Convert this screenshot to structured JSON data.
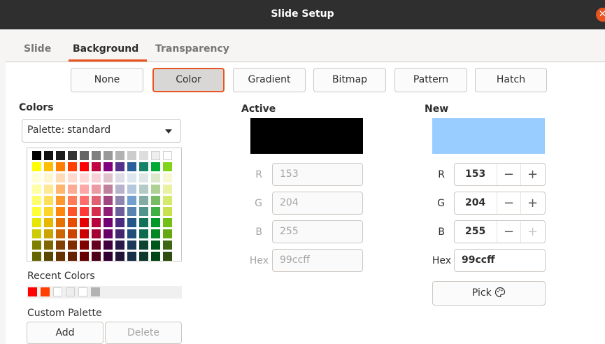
{
  "window": {
    "title": "Slide Setup"
  },
  "tabs": [
    "Slide",
    "Background",
    "Transparency"
  ],
  "fill_types": [
    "None",
    "Color",
    "Gradient",
    "Bitmap",
    "Pattern",
    "Hatch"
  ],
  "selected_fill_type": "Color",
  "colors": {
    "heading": "Colors",
    "palette_label": "Palette:",
    "palette_value": "standard",
    "recent_label": "Recent Colors",
    "custom_label": "Custom Palette",
    "add_label": "Add",
    "delete_label": "Delete"
  },
  "palette_grid": [
    [
      "#000000",
      "#111111",
      "#1c1c1c",
      "#333333",
      "#666666",
      "#808080",
      "#999999",
      "#b2b2b2",
      "#cccccc",
      "#dddddd",
      "#eeeeee",
      "#ffffff"
    ],
    [
      "#ffff00",
      "#ffbf00",
      "#ff8000",
      "#ff4000",
      "#ff0000",
      "#bf0041",
      "#800080",
      "#55308d",
      "#2a6099",
      "#158466",
      "#00a933",
      "#81d41a"
    ],
    [
      "#ffffd7",
      "#fff5ce",
      "#ffdbb6",
      "#ffd8ce",
      "#ffd7d7",
      "#f7d1d5",
      "#e0c2cd",
      "#dedce6",
      "#dee6ef",
      "#dee7e5",
      "#dde8cb",
      "#f6f9d4"
    ],
    [
      "#ffffa6",
      "#ffe994",
      "#ffb66c",
      "#ffaa95",
      "#ffa6a6",
      "#ec9ba4",
      "#bf819e",
      "#b7b3ca",
      "#b4c7dc",
      "#b3cac7",
      "#afd095",
      "#e8f2a1"
    ],
    [
      "#ffff6d",
      "#ffde59",
      "#ff972f",
      "#ff7b59",
      "#ff6d6d",
      "#e16173",
      "#a1467e",
      "#8e86ae",
      "#729fcf",
      "#81aca6",
      "#77bc65",
      "#d4ea6b"
    ],
    [
      "#ffff38",
      "#ffd428",
      "#ff860d",
      "#ff5429",
      "#ff3838",
      "#d62e4e",
      "#8d1d75",
      "#6b5e9b",
      "#5983b0",
      "#50938a",
      "#3faf46",
      "#c9e14f"
    ],
    [
      "#e6e600",
      "#e6b800",
      "#e67300",
      "#e64d00",
      "#e60000",
      "#b8003a",
      "#730073",
      "#4c2a7f",
      "#25568a",
      "#127259",
      "#009929",
      "#73bf15"
    ],
    [
      "#cccc00",
      "#cca300",
      "#cc6600",
      "#cc4400",
      "#cc0000",
      "#a30034",
      "#660066",
      "#432570",
      "#214d7a",
      "#0f6b4e",
      "#008724",
      "#66a812"
    ],
    [
      "#808000",
      "#7f6600",
      "#804000",
      "#802b00",
      "#800000",
      "#660020",
      "#400040",
      "#2a174a",
      "#1a3a59",
      "#0d4333",
      "#00551a",
      "#3e6613"
    ],
    [
      "#666600",
      "#594700",
      "#663300",
      "#662200",
      "#660000",
      "#4d0018",
      "#330033",
      "#221339",
      "#152f47",
      "#0a3829",
      "#004515",
      "#2e4d0e"
    ]
  ],
  "recent_colors": [
    "#ff0000",
    "#ff4000",
    "#ffffff",
    "#eeeeee",
    "#ffffff",
    "#b2b2b2"
  ],
  "active": {
    "heading": "Active",
    "color": "#000000",
    "r_label": "R",
    "r": "153",
    "g_label": "G",
    "g": "204",
    "b_label": "B",
    "b": "255",
    "hex_label": "Hex",
    "hex": "99ccff"
  },
  "new": {
    "heading": "New",
    "color": "#99ccff",
    "r_label": "R",
    "r": "153",
    "g_label": "G",
    "g": "204",
    "b_label": "B",
    "b": "255",
    "hex_label": "Hex",
    "hex": "99ccff",
    "minus_glyph": "−",
    "plus_glyph": "+",
    "pick_label": "Pick"
  },
  "accent_color": "#e95420"
}
